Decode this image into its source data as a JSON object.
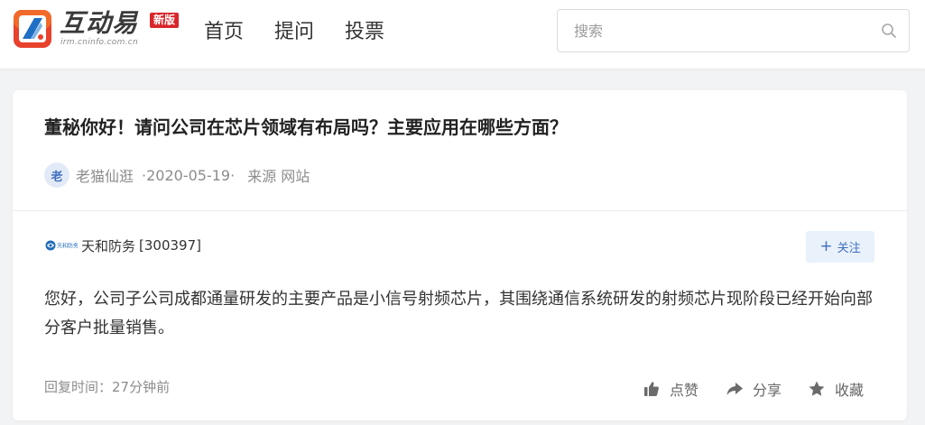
{
  "header": {
    "logo": {
      "title": "互动易",
      "url_text": "irm.cninfo.com.cn",
      "badge": "新版"
    },
    "nav": [
      {
        "label": "首页"
      },
      {
        "label": "提问"
      },
      {
        "label": "投票"
      }
    ],
    "search": {
      "placeholder": "搜索",
      "value": "",
      "icon": "search-icon"
    }
  },
  "question": {
    "title": "董秘你好！请问公司在芯片领域有布局吗？主要应用在哪些方面？",
    "asker": {
      "avatar_char": "老",
      "name": "老猫仙逛"
    },
    "date": "2020-05-19",
    "separator_left": "·",
    "separator_right": "·",
    "source_label": "来源",
    "source_value": "网站"
  },
  "answer": {
    "company_logo_text": "天和防务",
    "company_name": "天和防务",
    "company_code": "[300397]",
    "follow_label": "关注",
    "text": "您好，公司子公司成都通量研发的主要产品是小信号射频芯片，其围绕通信系统研发的射频芯片现阶段已经开始向部分客户批量销售。",
    "reply_time": "回复时间：27分钟前",
    "actions": {
      "like": "点赞",
      "share": "分享",
      "collect": "收藏"
    }
  },
  "colors": {
    "brand_red": "#d8262b",
    "accent_blue": "#3f6fc0",
    "follow_bg": "#e9f1fb",
    "page_bg": "#f2f3f5"
  }
}
